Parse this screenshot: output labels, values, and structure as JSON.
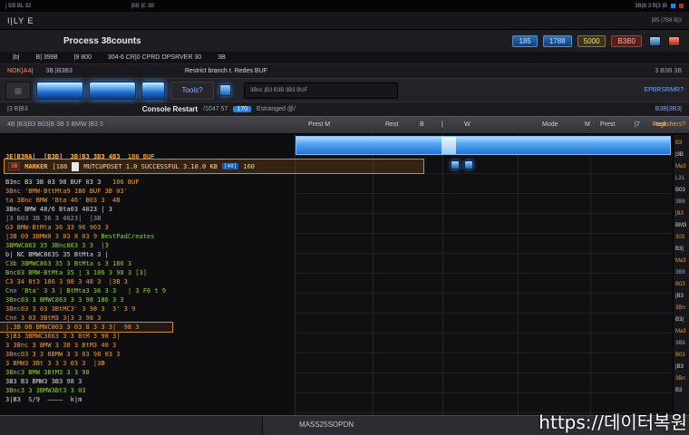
{
  "accent_colors": {
    "blue": "#2a7fe0",
    "orange": "#e09a3a",
    "green": "#93c93f",
    "selection_blue": "#55a5f2"
  },
  "titlebar": {
    "left_text": "| EB BL 32",
    "mid_text": "|BB |E 3B",
    "right_text": "3B|B 3 B|3 |B"
  },
  "menubar": {
    "app_label": "I|LY E",
    "right_text": "|B5  |7B8  B|3"
  },
  "procrow": {
    "title": "Process 38counts",
    "badges": [
      {
        "t": "185",
        "c": "chip-blue"
      },
      {
        "t": "1788",
        "c": "chip-blue"
      },
      {
        "t": "5000",
        "c": "chip-yellow"
      },
      {
        "t": "B3B0",
        "c": "chip-red"
      }
    ]
  },
  "menurow": {
    "items": [
      {
        "t": "|b|"
      },
      {
        "t": "B| 3998"
      },
      {
        "t": "|9 800"
      },
      {
        "t": "304-6 CR|0 CPRD OPSRVER 30"
      },
      {
        "t": "3B"
      }
    ]
  },
  "subrow": {
    "left_red": "NOK|A4|",
    "left_text": "3B |B3B3",
    "center": "Restrict branch t. Redes BUF",
    "right": "3 B3B 3B"
  },
  "toolbar": {
    "grid_button": "▦",
    "tools_label": "Tools?",
    "panel_text": "3Bnc |B3 B3B 3B3 BUF",
    "right_text": "EPBRSRMR?"
  },
  "headerstrip": {
    "left_text": "|3 B|B3",
    "title": "Console Restart",
    "mid": "/1047 57",
    "badge": "170",
    "tail": "Estranged @/",
    "right_text": "B3B|3B3|"
  },
  "colheader": {
    "left_text": "4B |B3|B3 B03|B 3B 3 BMW |B3 3",
    "right_text": "Fuglishers?",
    "columns": [
      "Prest M",
      "Rest",
      "B",
      "|",
      "W",
      "Mode",
      "M",
      "Prest",
      "|7",
      "Rest"
    ]
  },
  "orangerow": {
    "chip": "3B",
    "label": "MARKER",
    "num": "[188",
    "text": "MUTCUPOSET 1.0 SUCCESSFUL 3.10.0 KB",
    "chip2": "[40]",
    "chip3": "160"
  },
  "code": {
    "lines": [
      {
        "c": "orange-b",
        "t": "JE|B3RA|  [B3B]  3B|B3 3B3 4B3",
        "t2": "  1B6 BUF",
        "c2": "orange"
      },
      {
        "c": "spacer",
        "t": ""
      },
      {
        "c": "white",
        "t": "B3nc B3 3B 03 98 BUF 03 3   ",
        "t2": "186 BUF",
        "c2": "orange"
      },
      {
        "c": "orange",
        "t": "3Bnc 'BMW-BttMta9 1B6 BUF 3B 03'"
      },
      {
        "c": "orange",
        "t": "ta 3Bnc BMW 'Bta 46' B03 3  4B"
      },
      {
        "c": "white",
        "t": "3Bnc BMW 48/6 Bta03 4023 | 3"
      },
      {
        "c": "gray",
        "t": "|3 B03 3B 36 3 4023|  |3B"
      },
      {
        "c": "orange",
        "t": "G3 BMW-BtMta 36 33 96 903 3"
      },
      {
        "c": "orange",
        "t": "|3B 09 3BMW8 3 03 8 03 9 ",
        "t2": "BestPadCreates",
        "c2": "green"
      },
      {
        "c": "green",
        "t": "3BMWC863 35 3Bnc863 3 3  |3"
      },
      {
        "c": "white",
        "t": "b| NC BMWC863S 35 BtMta 3 |"
      },
      {
        "c": "green",
        "t": "C3b 3BMWC863 35 3 BtMta s 3 186 3"
      },
      {
        "c": "green",
        "t": "Bnc03 BMW-BtMta 35 | 3 186 3 98 3 [3]"
      },
      {
        "c": "orange",
        "t": "C3 34 8t3 186 3 98 3 48 3  |3B 3"
      },
      {
        "c": "green",
        "t": "Cnn 'Bta' 3 3 | BtMta3 36 3 3   | 3 F0 t 9"
      },
      {
        "c": "green",
        "t": "3Bnc03 3 BMWC863 3 3 98 186 3 3"
      },
      {
        "c": "orange",
        "t": "3Bnc03 3 03 3BtMC3' 3 98 3  3' 3 9"
      },
      {
        "c": "orange",
        "t": "Cnn 3 03 3BtM3 3|3 3 98 3"
      },
      {
        "c": "orange",
        "boxed": true,
        "t": "|.3B 08 BMWC863 3 03 8 3 3 3|  98 3"
      },
      {
        "c": "orange",
        "t": "3|B3 3BMWC3863 3 3 BtM 3 98 3|"
      },
      {
        "c": "orange",
        "t": "3 3Bnc 3 BMW 3 38 3 BtM3 40 3"
      },
      {
        "c": "orange",
        "t": "3Bnc03 3 3 8BMW 3 3 03 98 03 3"
      },
      {
        "c": "orange",
        "t": "3 BMW3 3Bt 3 3 3 03 3  |3B"
      },
      {
        "c": "green",
        "t": "3Bnc3 BMW 3BtM3 3 3 98"
      },
      {
        "c": "white",
        "t": "3B3 B3 BMW3 3B3 98 3"
      },
      {
        "c": "green",
        "t": "3Bnc3 3 3BMW3Bt3 3 03"
      },
      {
        "c": "white",
        "t": "3|B3  S/9  ————  k|m"
      }
    ]
  },
  "sidebar": {
    "lines": [
      {
        "c": "orange",
        "t": "B3"
      },
      {
        "c": "white",
        "t": "|3B"
      },
      {
        "c": "orange",
        "t": "Ma3"
      },
      {
        "c": "orange",
        "t": "L31"
      },
      {
        "c": "white",
        "t": "B03"
      },
      {
        "c": "blue",
        "t": "3B8"
      },
      {
        "c": "orange",
        "t": "|B3"
      },
      {
        "c": "white",
        "t": "BM3"
      },
      {
        "c": "orange",
        "t": "303"
      },
      {
        "c": "white",
        "t": "B3|"
      },
      {
        "c": "orange",
        "t": "Ma3"
      },
      {
        "c": "blue",
        "t": "3B8"
      },
      {
        "c": "orange",
        "t": "B03"
      },
      {
        "c": "white",
        "t": "|B3"
      },
      {
        "c": "orange",
        "t": "3Bn"
      },
      {
        "c": "white",
        "t": "B3|"
      },
      {
        "c": "orange",
        "t": "Ma3"
      },
      {
        "c": "blue",
        "t": "3B8"
      },
      {
        "c": "orange",
        "t": "B03"
      },
      {
        "c": "white",
        "t": "|B3"
      },
      {
        "c": "orange",
        "t": "3Bn"
      },
      {
        "c": "white",
        "t": "B3"
      }
    ]
  },
  "statusbar": {
    "center": "MASS25SOPDN"
  },
  "watermark": {
    "text": "https://데이터복원"
  }
}
